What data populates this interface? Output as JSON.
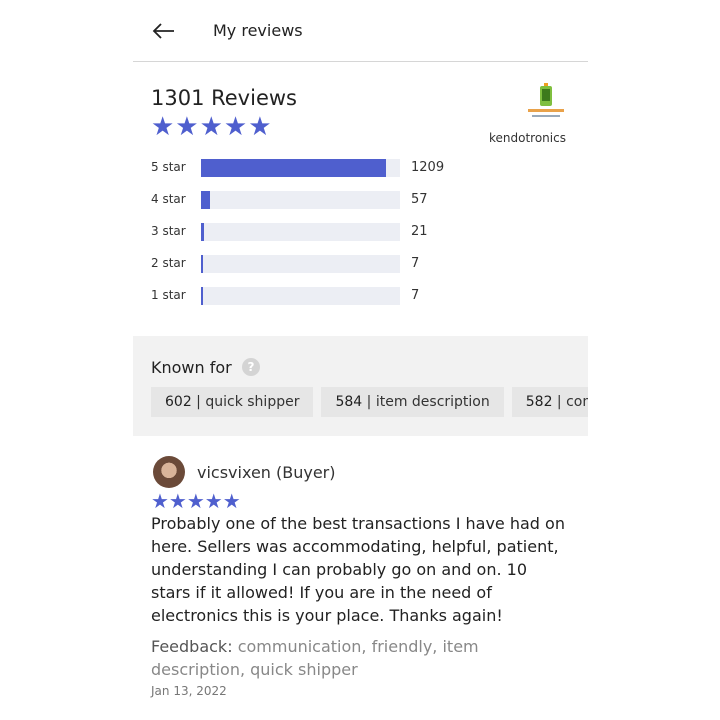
{
  "header": {
    "title": "My reviews"
  },
  "summary": {
    "total_text": "1301 Reviews",
    "stars": "★★★★★",
    "seller_name": "kendotronics",
    "distribution": [
      {
        "label": "5 star",
        "count": "1209",
        "fraction": 0.93
      },
      {
        "label": "4 star",
        "count": "57",
        "fraction": 0.044
      },
      {
        "label": "3 star",
        "count": "21",
        "fraction": 0.016
      },
      {
        "label": "2 star",
        "count": "7",
        "fraction": 0.005
      },
      {
        "label": "1 star",
        "count": "7",
        "fraction": 0.005
      }
    ]
  },
  "known_for": {
    "title": "Known for",
    "help_icon": "?",
    "chips": [
      {
        "count": "602",
        "label": "quick shipper"
      },
      {
        "count": "584",
        "label": "item description"
      },
      {
        "count": "582",
        "label": "communication"
      }
    ]
  },
  "review": {
    "reviewer": "vicsvixen (Buyer)",
    "stars": "★★★★★",
    "text": "Probably one of the best transactions I have had on here. Sellers was accommodating, helpful, patient, understanding I can probably go on and on. 10 stars if it allowed! If you are in the need of electronics this is your place. Thanks again!",
    "feedback_label": "Feedback:",
    "feedback_tags": "communication, friendly, item description, quick shipper",
    "date": "Jan 13, 2022"
  },
  "colors": {
    "accent": "#4f5fce",
    "track": "#eceef4",
    "known_bg": "#f2f2f2"
  },
  "icons": {
    "back": "arrow-left-icon",
    "help": "question-circle-icon"
  }
}
